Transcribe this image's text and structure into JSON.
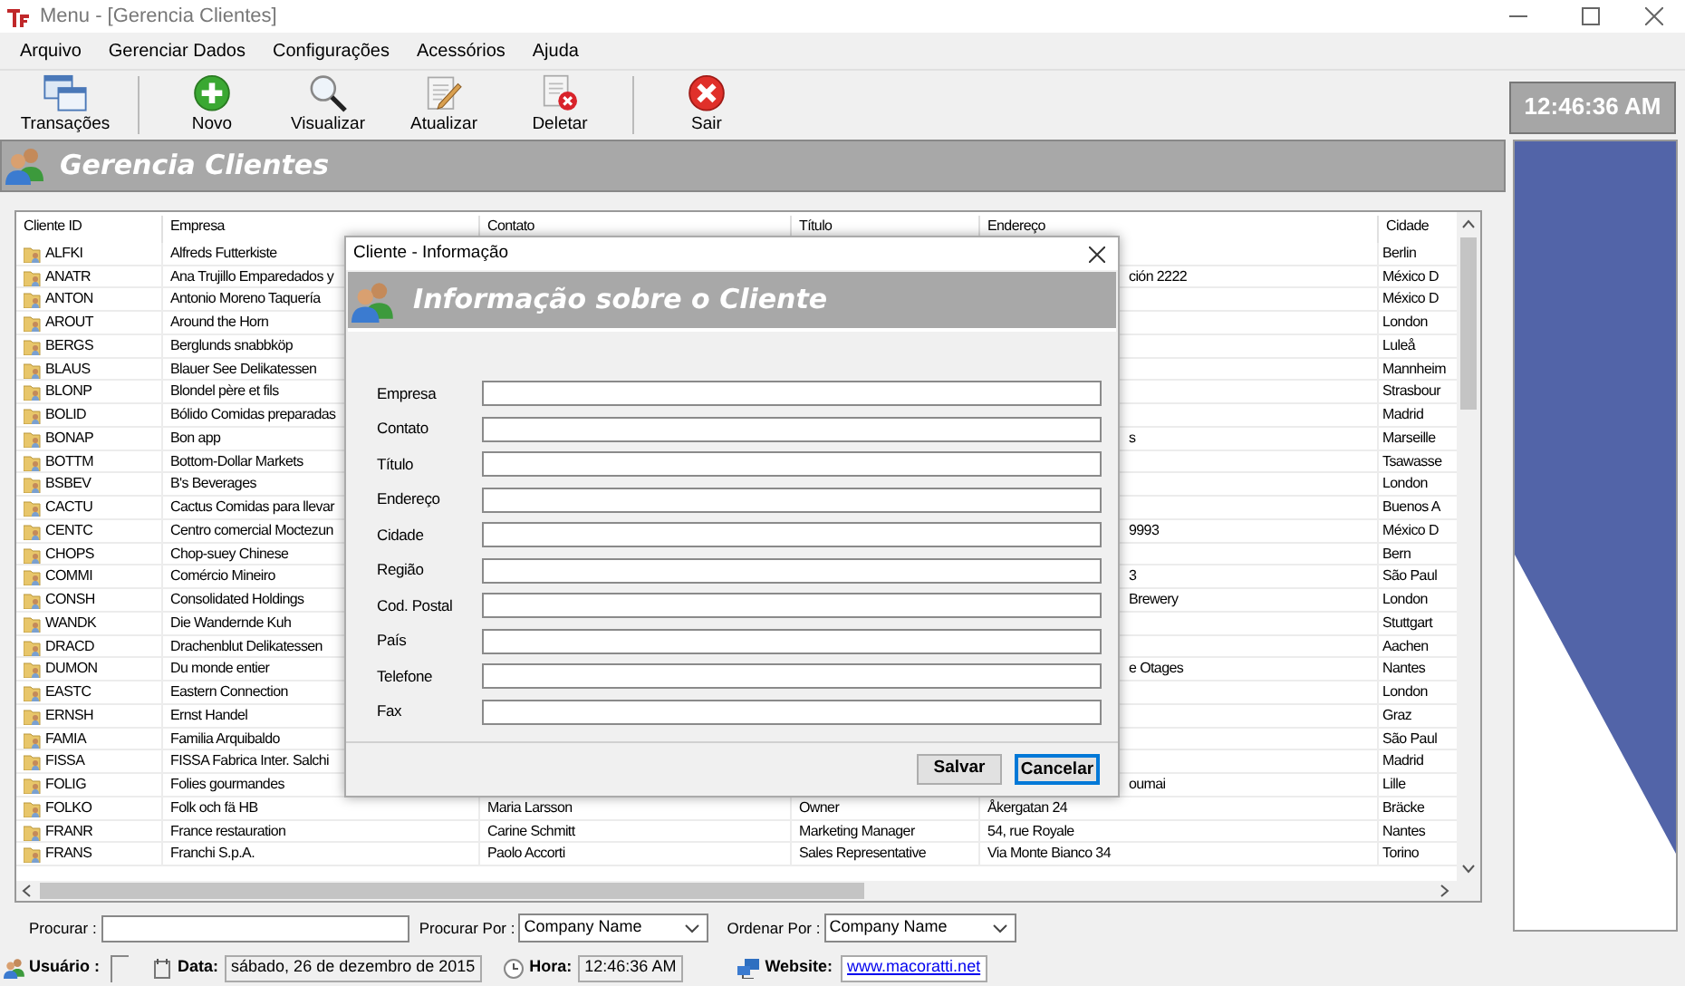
{
  "window": {
    "title": "Menu - [Gerencia Clientes]"
  },
  "menu": [
    "Arquivo",
    "Gerenciar Dados",
    "Configurações",
    "Acessórios",
    "Ajuda"
  ],
  "toolbar": [
    {
      "label": "Transações",
      "kind": "windows",
      "separator_before": false
    },
    {
      "label": "Novo",
      "kind": "add",
      "separator_before": true
    },
    {
      "label": "Visualizar",
      "kind": "view",
      "separator_before": false
    },
    {
      "label": "Atualizar",
      "kind": "edit",
      "separator_before": false
    },
    {
      "label": "Deletar",
      "kind": "delete",
      "separator_before": false
    },
    {
      "label": "Sair",
      "kind": "exit",
      "separator_before": true
    }
  ],
  "clock": "12:46:36 AM",
  "panel": {
    "title": "Gerencia Clientes"
  },
  "table": {
    "columns": [
      "Cliente ID",
      "Empresa",
      "Contato",
      "Título",
      "Endereço",
      "Cidade"
    ],
    "rows": [
      {
        "id": "ALFKI",
        "empresa": "Alfreds Futterkiste",
        "cidade": "Berlin"
      },
      {
        "id": "ANATR",
        "empresa": "Ana Trujillo Emparedados y",
        "endereco": "ción 2222",
        "cidade": "México D"
      },
      {
        "id": "ANTON",
        "empresa": "Antonio Moreno Taquería",
        "cidade": "México D"
      },
      {
        "id": "AROUT",
        "empresa": "Around the Horn",
        "cidade": "London"
      },
      {
        "id": "BERGS",
        "empresa": "Berglunds snabbköp",
        "cidade": "Luleå"
      },
      {
        "id": "BLAUS",
        "empresa": "Blauer See Delikatessen",
        "cidade": "Mannheim"
      },
      {
        "id": "BLONP",
        "empresa": "Blondel père et fils",
        "cidade": "Strasbour"
      },
      {
        "id": "BOLID",
        "empresa": "Bólido Comidas preparadas",
        "cidade": "Madrid"
      },
      {
        "id": "BONAP",
        "empresa": "Bon app",
        "endereco": "s",
        "cidade": "Marseille"
      },
      {
        "id": "BOTTM",
        "empresa": "Bottom-Dollar Markets",
        "cidade": "Tsawasse"
      },
      {
        "id": "BSBEV",
        "empresa": "B's Beverages",
        "cidade": "London"
      },
      {
        "id": "CACTU",
        "empresa": "Cactus Comidas para llevar",
        "cidade": "Buenos A"
      },
      {
        "id": "CENTC",
        "empresa": "Centro comercial Moctezun",
        "endereco": "9993",
        "cidade": "México D"
      },
      {
        "id": "CHOPS",
        "empresa": "Chop-suey Chinese",
        "cidade": "Bern"
      },
      {
        "id": "COMMI",
        "empresa": "Comércio Mineiro",
        "endereco": "3",
        "cidade": "São Paul"
      },
      {
        "id": "CONSH",
        "empresa": "Consolidated Holdings",
        "endereco": "Brewery",
        "cidade": "London"
      },
      {
        "id": "WANDK",
        "empresa": "Die Wandernde Kuh",
        "cidade": "Stuttgart"
      },
      {
        "id": "DRACD",
        "empresa": "Drachenblut Delikatessen",
        "cidade": "Aachen"
      },
      {
        "id": "DUMON",
        "empresa": "Du monde entier",
        "endereco": "e Otages",
        "cidade": "Nantes"
      },
      {
        "id": "EASTC",
        "empresa": "Eastern Connection",
        "cidade": "London"
      },
      {
        "id": "ERNSH",
        "empresa": "Ernst Handel",
        "cidade": "Graz"
      },
      {
        "id": "FAMIA",
        "empresa": "Familia Arquibaldo",
        "cidade": "São Paul"
      },
      {
        "id": "FISSA",
        "empresa": "FISSA Fabrica Inter. Salchi",
        "cidade": "Madrid"
      },
      {
        "id": "FOLIG",
        "empresa": "Folies gourmandes",
        "endereco": "oumai",
        "cidade": "Lille"
      },
      {
        "id": "FOLKO",
        "empresa": "Folk och fä HB",
        "contato": "Maria Larsson",
        "titulo": "Owner",
        "endereco": "Åkergatan 24",
        "cidade": "Bräcke"
      },
      {
        "id": "FRANR",
        "empresa": "France restauration",
        "contato": "Carine Schmitt",
        "titulo": "Marketing Manager",
        "endereco": "54, rue Royale",
        "cidade": "Nantes"
      },
      {
        "id": "FRANS",
        "empresa": "Franchi S.p.A.",
        "contato": "Paolo Accorti",
        "titulo": "Sales Representative",
        "endereco": "Via Monte Bianco 34",
        "cidade": "Torino"
      }
    ]
  },
  "search": {
    "label": "Procurar :",
    "by_label": "Procurar Por :",
    "by_value": "Company Name",
    "order_label": "Ordenar Por :",
    "order_value": "Company Name"
  },
  "status_bar": {
    "user_label": "Usuário :",
    "date_label": "Data:",
    "date": "sábado, 26 de dezembro de 2015",
    "time_label": "Hora:",
    "time": "12:46:36 AM",
    "website_label": "Website:",
    "website": "www.macoratti.net"
  },
  "dialog": {
    "title": "Cliente - Informação",
    "heading": "Informação sobre o Cliente",
    "fields": [
      "Empresa",
      "Contato",
      "Título",
      "Endereço",
      "Cidade",
      "Região",
      "Cod. Postal",
      "País",
      "Telefone",
      "Fax"
    ],
    "buttons": [
      {
        "label": "Salvar",
        "focused": false
      },
      {
        "label": "Cancelar",
        "focused": true
      }
    ]
  }
}
